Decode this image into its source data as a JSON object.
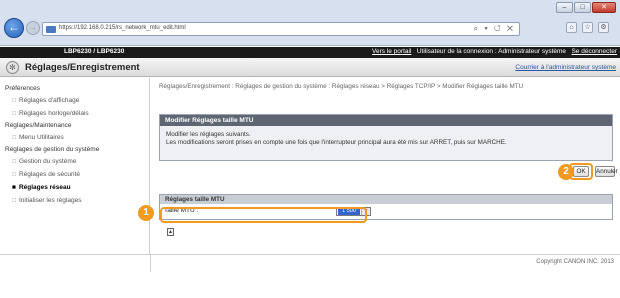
{
  "browser": {
    "url": "https://192.168.0.215/rs_network_mtu_edit.html",
    "address_tools": "⌕ ▾ ↺ ✕",
    "win_minimize": "–",
    "win_maximize": "□",
    "win_close": "✕",
    "toolbar_icons": [
      "home-icon",
      "star-icon",
      "gear-icon"
    ]
  },
  "printer_header": {
    "model": "LBP6230 / LBP6230",
    "portal_link": "Vers le portail",
    "login_user": "Utilisateur de la connexion : Administrateur système",
    "logout_link": "Se déconnecter"
  },
  "title_bar": {
    "title": "Réglages/Enregistrement",
    "mail_link": "Courrier à l'administrateur système"
  },
  "sidebar": {
    "group1": "Préférences",
    "group1_items": [
      "Réglages d'affichage",
      "Réglages horloge/délais"
    ],
    "group2": "Réglages/Maintenance",
    "group2_items": [
      "Menu Utilitaires"
    ],
    "group3": "Réglages de gestion du système",
    "group3_items": [
      "Gestion du système",
      "Réglages de sécurité",
      "Réglages réseau",
      "Initialiser les réglages"
    ],
    "active_item": "Réglages réseau"
  },
  "main": {
    "breadcrumb": "Réglages/Enregistrement : Réglages de gestion du système : Réglages réseau > Réglages TCP/IP > Modifier Réglages taille MTU",
    "panel_title": "Modifier Réglages taille MTU",
    "instruction": "Modifier les réglages suivants.",
    "notice": "Les modifications seront prises en compte une fois que l'interrupteur principal aura été mis sur ARRET, puis sur MARCHE.",
    "ok_button": "OK",
    "cancel_button": "Annuler",
    "settings_header": "Réglages taille MTU",
    "mtu_label": "Taille MTU :",
    "mtu_value": "1 500",
    "footer_copyright": "Copyright CANON INC. 2013"
  },
  "callouts": {
    "step1": "1",
    "step2": "2",
    "color": "#f29a1f"
  }
}
